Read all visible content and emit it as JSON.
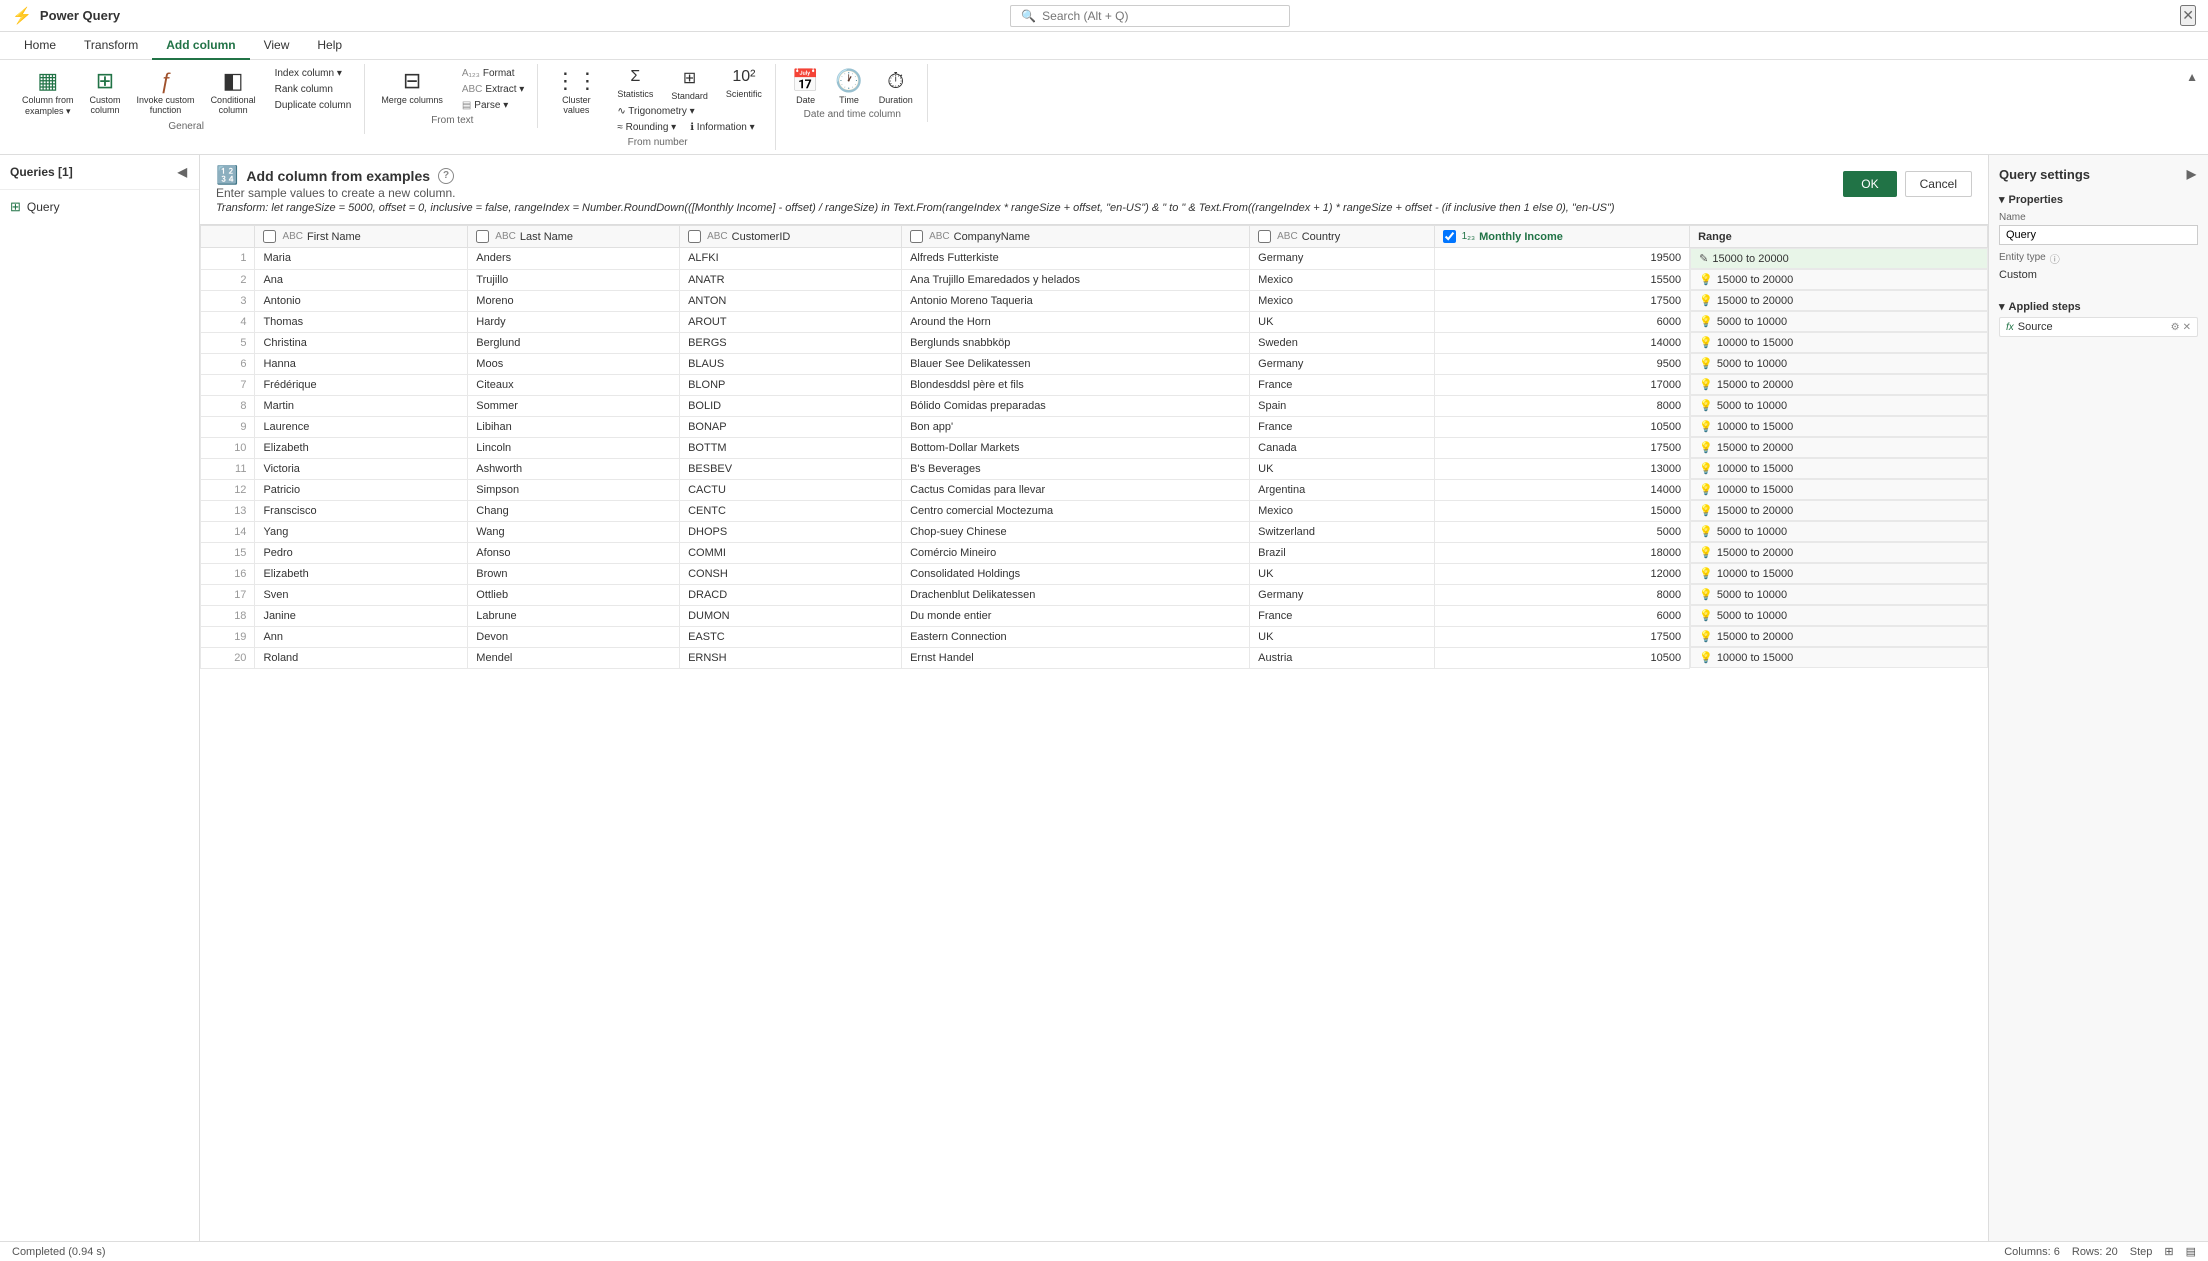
{
  "app": {
    "title": "Power Query",
    "close_label": "✕"
  },
  "search": {
    "placeholder": "Search (Alt + Q)"
  },
  "ribbon": {
    "tabs": [
      "Home",
      "Transform",
      "Add column",
      "View",
      "Help"
    ],
    "active_tab": "Add column",
    "groups": {
      "general": {
        "label": "General",
        "items": [
          {
            "id": "col-from-examples",
            "label": "Column from\nexamples",
            "icon": "▦"
          },
          {
            "id": "custom-column",
            "label": "Custom\ncolumn",
            "icon": "⊞"
          },
          {
            "id": "invoke-custom",
            "label": "Invoke custom\nfunction",
            "icon": "ƒ"
          },
          {
            "id": "conditional-col",
            "label": "Conditional\ncolumn",
            "icon": "◧"
          }
        ],
        "small_items": [
          {
            "id": "index-col",
            "label": "Index column ▾"
          },
          {
            "id": "rank-col",
            "label": "Rank column"
          },
          {
            "id": "duplicate-col",
            "label": "Duplicate column"
          }
        ]
      },
      "from_text": {
        "label": "From text",
        "items": [
          {
            "id": "format",
            "label": "Format",
            "icon": "A₁₂₃"
          },
          {
            "id": "extract",
            "label": "Extract ▾",
            "icon": "ABC"
          },
          {
            "id": "parse",
            "label": "Parse ▾",
            "icon": "▤"
          }
        ],
        "big_items": [
          {
            "id": "merge-cols",
            "label": "Merge columns",
            "icon": "⊟"
          }
        ]
      },
      "from_number": {
        "label": "From number",
        "items": [
          {
            "id": "statistics",
            "label": "Statistics",
            "icon": "Σ"
          },
          {
            "id": "standard",
            "label": "Standard",
            "icon": "⊞"
          },
          {
            "id": "scientific",
            "label": "Scientific\n10²",
            "icon": "10²"
          },
          {
            "id": "trigonometry",
            "label": "Trigonometry ▾",
            "icon": "∿"
          },
          {
            "id": "rounding",
            "label": "Rounding ▾",
            "icon": "≈"
          },
          {
            "id": "information",
            "label": "Information ▾",
            "icon": "ℹ"
          }
        ],
        "big_items": [
          {
            "id": "cluster-values",
            "label": "Cluster\nvalues",
            "icon": "⋮⋮"
          }
        ]
      },
      "date_time": {
        "label": "Date and time column",
        "items": [
          {
            "id": "date",
            "label": "Date",
            "icon": "📅"
          },
          {
            "id": "time",
            "label": "Time",
            "icon": "🕐"
          },
          {
            "id": "duration",
            "label": "Duration",
            "icon": "⏱"
          }
        ]
      }
    }
  },
  "queries_panel": {
    "title": "Queries [1]",
    "queries": [
      {
        "name": "Query",
        "icon": "table"
      }
    ]
  },
  "dialog": {
    "title": "Add column from examples",
    "icon": "🔢",
    "subtitle": "Enter sample values to create a new column.",
    "transform": "Transform: let rangeSize = 5000, offset = 0, inclusive = false, rangeIndex = Number.RoundDown(([Monthly Income] - offset) / rangeSize) in Text.From(rangeIndex * rangeSize + offset, \"en-US\") & \" to \" & Text.From((rangeIndex + 1) * rangeSize + offset - (if inclusive then 1 else 0), \"en-US\")",
    "ok_label": "OK",
    "cancel_label": "Cancel",
    "help_label": "?"
  },
  "table": {
    "columns": [
      {
        "id": "first-name",
        "label": "First Name",
        "type": "ABC",
        "checked": false
      },
      {
        "id": "last-name",
        "label": "Last Name",
        "type": "ABC",
        "checked": false
      },
      {
        "id": "customer-id",
        "label": "CustomerID",
        "type": "ABC",
        "checked": false
      },
      {
        "id": "company-name",
        "label": "CompanyName",
        "type": "ABC",
        "checked": false
      },
      {
        "id": "country",
        "label": "Country",
        "type": "ABC",
        "checked": false
      },
      {
        "id": "monthly-income",
        "label": "Monthly Income",
        "type": "1₂₃",
        "checked": true
      },
      {
        "id": "range",
        "label": "Range",
        "type": "",
        "checked": false,
        "new": true
      }
    ],
    "rows": [
      {
        "num": 1,
        "first": "Maria",
        "last": "Anders",
        "cid": "ALFKI",
        "company": "Alfreds Futterkiste",
        "country": "Germany",
        "income": "19500",
        "range": "15000 to 20000",
        "editing": true
      },
      {
        "num": 2,
        "first": "Ana",
        "last": "Trujillo",
        "cid": "ANATR",
        "company": "Ana Trujillo Emaredados y helados",
        "country": "Mexico",
        "income": "15500",
        "range": "15000 to 20000",
        "editing": false
      },
      {
        "num": 3,
        "first": "Antonio",
        "last": "Moreno",
        "cid": "ANTON",
        "company": "Antonio Moreno Taqueria",
        "country": "Mexico",
        "income": "17500",
        "range": "15000 to 20000",
        "editing": false
      },
      {
        "num": 4,
        "first": "Thomas",
        "last": "Hardy",
        "cid": "AROUT",
        "company": "Around the Horn",
        "country": "UK",
        "income": "6000",
        "range": "5000 to 10000",
        "editing": false
      },
      {
        "num": 5,
        "first": "Christina",
        "last": "Berglund",
        "cid": "BERGS",
        "company": "Berglunds snabbköp",
        "country": "Sweden",
        "income": "14000",
        "range": "10000 to 15000",
        "editing": false
      },
      {
        "num": 6,
        "first": "Hanna",
        "last": "Moos",
        "cid": "BLAUS",
        "company": "Blauer See Delikatessen",
        "country": "Germany",
        "income": "9500",
        "range": "5000 to 10000",
        "editing": false
      },
      {
        "num": 7,
        "first": "Frédérique",
        "last": "Citeaux",
        "cid": "BLONP",
        "company": "Blondesddsl père et fils",
        "country": "France",
        "income": "17000",
        "range": "15000 to 20000",
        "editing": false
      },
      {
        "num": 8,
        "first": "Martin",
        "last": "Sommer",
        "cid": "BOLID",
        "company": "Bólido Comidas preparadas",
        "country": "Spain",
        "income": "8000",
        "range": "5000 to 10000",
        "editing": false
      },
      {
        "num": 9,
        "first": "Laurence",
        "last": "Libihan",
        "cid": "BONAP",
        "company": "Bon app'",
        "country": "France",
        "income": "10500",
        "range": "10000 to 15000",
        "editing": false
      },
      {
        "num": 10,
        "first": "Elizabeth",
        "last": "Lincoln",
        "cid": "BOTTM",
        "company": "Bottom-Dollar Markets",
        "country": "Canada",
        "income": "17500",
        "range": "15000 to 20000",
        "editing": false
      },
      {
        "num": 11,
        "first": "Victoria",
        "last": "Ashworth",
        "cid": "BESBEV",
        "company": "B's Beverages",
        "country": "UK",
        "income": "13000",
        "range": "10000 to 15000",
        "editing": false
      },
      {
        "num": 12,
        "first": "Patricio",
        "last": "Simpson",
        "cid": "CACTU",
        "company": "Cactus Comidas para llevar",
        "country": "Argentina",
        "income": "14000",
        "range": "10000 to 15000",
        "editing": false
      },
      {
        "num": 13,
        "first": "Franscisco",
        "last": "Chang",
        "cid": "CENTC",
        "company": "Centro comercial Moctezuma",
        "country": "Mexico",
        "income": "15000",
        "range": "15000 to 20000",
        "editing": false
      },
      {
        "num": 14,
        "first": "Yang",
        "last": "Wang",
        "cid": "DHOPS",
        "company": "Chop-suey Chinese",
        "country": "Switzerland",
        "income": "5000",
        "range": "5000 to 10000",
        "editing": false
      },
      {
        "num": 15,
        "first": "Pedro",
        "last": "Afonso",
        "cid": "COMMI",
        "company": "Comércio Mineiro",
        "country": "Brazil",
        "income": "18000",
        "range": "15000 to 20000",
        "editing": false
      },
      {
        "num": 16,
        "first": "Elizabeth",
        "last": "Brown",
        "cid": "CONSH",
        "company": "Consolidated Holdings",
        "country": "UK",
        "income": "12000",
        "range": "10000 to 15000",
        "editing": false
      },
      {
        "num": 17,
        "first": "Sven",
        "last": "Ottlieb",
        "cid": "DRACD",
        "company": "Drachenblut Delikatessen",
        "country": "Germany",
        "income": "8000",
        "range": "5000 to 10000",
        "editing": false
      },
      {
        "num": 18,
        "first": "Janine",
        "last": "Labrune",
        "cid": "DUMON",
        "company": "Du monde entier",
        "country": "France",
        "income": "6000",
        "range": "5000 to 10000",
        "editing": false
      },
      {
        "num": 19,
        "first": "Ann",
        "last": "Devon",
        "cid": "EASTC",
        "company": "Eastern Connection",
        "country": "UK",
        "income": "17500",
        "range": "15000 to 20000",
        "editing": false
      },
      {
        "num": 20,
        "first": "Roland",
        "last": "Mendel",
        "cid": "ERNSH",
        "company": "Ernst Handel",
        "country": "Austria",
        "income": "10500",
        "range": "10000 to 15000",
        "editing": false
      }
    ]
  },
  "settings": {
    "title": "Query settings",
    "properties_label": "Properties",
    "name_label": "Name",
    "name_value": "Query",
    "entity_type_label": "Entity type",
    "entity_type_value": "Custom",
    "applied_steps_label": "Applied steps",
    "steps": [
      {
        "label": "Source",
        "has_settings": true
      }
    ]
  },
  "status_bar": {
    "left": "Completed (0.94 s)",
    "columns": "Columns: 6",
    "rows": "Rows: 20",
    "step_label": "Step"
  }
}
